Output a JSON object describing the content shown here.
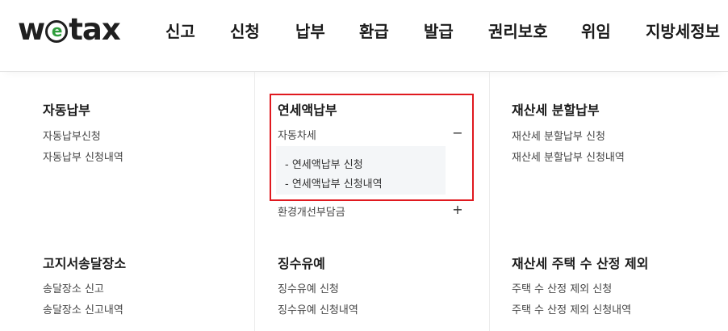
{
  "logo": {
    "prefix": "w",
    "suffix": "tax"
  },
  "nav": [
    {
      "label": "신고"
    },
    {
      "label": "신청"
    },
    {
      "label": "납부"
    },
    {
      "label": "환급"
    },
    {
      "label": "발급"
    },
    {
      "label": "권리보호"
    },
    {
      "label": "위임"
    },
    {
      "label": "지방세정보"
    }
  ],
  "menu": {
    "auto_payment": {
      "title": "자동납부",
      "links": [
        "자동납부신청",
        "자동납부 신청내역"
      ]
    },
    "annual_payment": {
      "title": "연세액납부",
      "items": [
        {
          "label": "자동차세",
          "toggle": "−",
          "sub": [
            "- 연세액납부 신청",
            "- 연세액납부 신청내역"
          ]
        },
        {
          "label": "환경개선부담금",
          "toggle": "+"
        }
      ]
    },
    "property_split": {
      "title": "재산세 분할납부",
      "links": [
        "재산세 분할납부 신청",
        "재산세 분할납부 신청내역"
      ]
    },
    "notice_address": {
      "title": "고지서송달장소",
      "links": [
        "송달장소 신고",
        "송달장소 신고내역"
      ]
    },
    "deferral": {
      "title": "징수유예",
      "links": [
        "징수유예 신청",
        "징수유예 신청내역"
      ]
    },
    "house_count": {
      "title": "재산세 주택 수 산정 제외",
      "links": [
        "주택 수 산정 제외 신청",
        "주택 수 산정 제외 신청내역"
      ]
    }
  },
  "colors": {
    "highlight_border": "#e0191f",
    "logo_accent": "#2f9e3c"
  }
}
